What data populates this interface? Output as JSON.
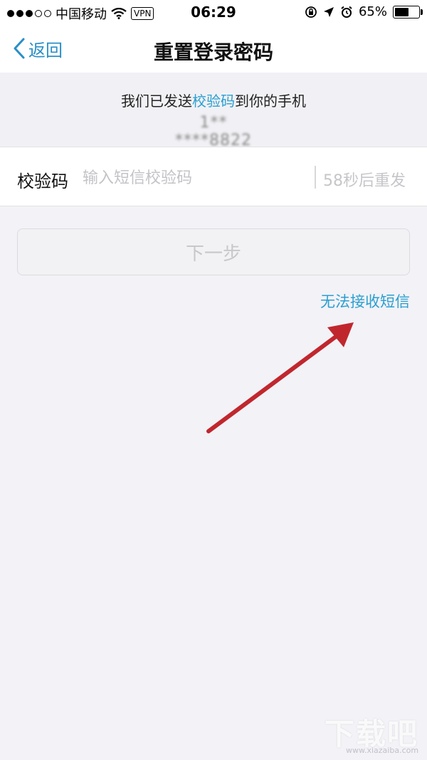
{
  "status_bar": {
    "carrier": "中国移动",
    "vpn": "VPN",
    "time": "06:29",
    "battery": "65%",
    "battery_level": 0.65,
    "signal_bars_filled": 3,
    "signal_bars_total": 5
  },
  "nav": {
    "back_label": "返回",
    "title": "重置登录密码"
  },
  "info": {
    "prefix": "我们已发送",
    "highlight": "校验码",
    "suffix": "到你的手机",
    "phone_masked": "1**  ****8822"
  },
  "code_field": {
    "label": "校验码",
    "placeholder": "输入短信校验码",
    "value": "",
    "resend_label": "58秒后重发"
  },
  "next_button": {
    "label": "下一步"
  },
  "cannot_receive_link": "无法接收短信",
  "watermark": {
    "text": "下载吧",
    "url": "www.xiazaiba.com"
  },
  "colors": {
    "accent": "#2a9fd0",
    "arrow": "#c0272d",
    "background": "#f3f2f7"
  },
  "icons": [
    "signal-dots-icon",
    "wifi-icon",
    "rotation-lock-icon",
    "location-arrow-icon",
    "alarm-icon",
    "battery-icon",
    "back-chevron-icon"
  ]
}
